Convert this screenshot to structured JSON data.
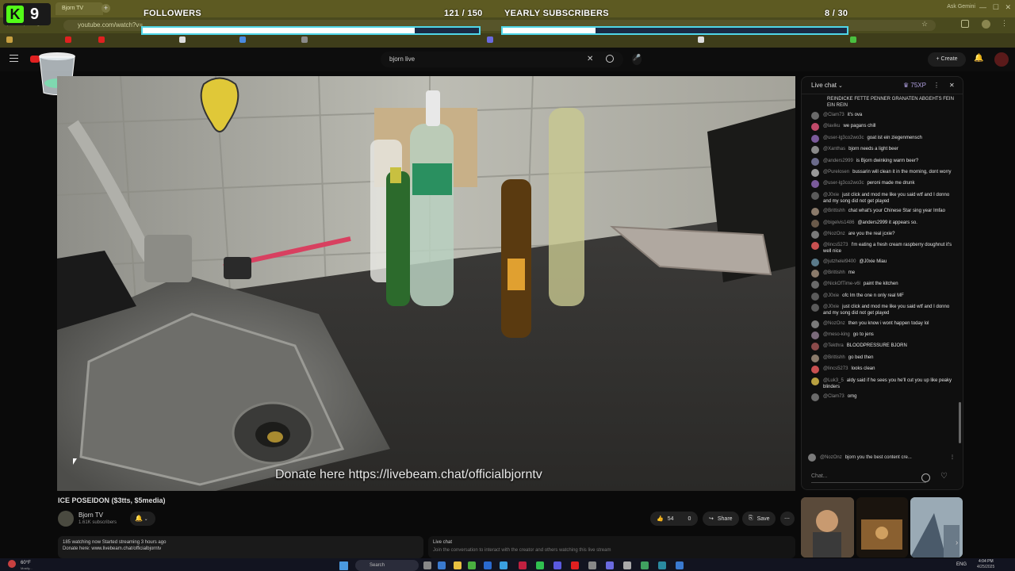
{
  "browser": {
    "tab_label": "Bjorn TV",
    "url": "youtube.com/watch?v=",
    "ask_gemini": "Ask Gemini"
  },
  "overlay": {
    "kick_level": "9",
    "followers_label": "FOLLOWERS",
    "followers_count": "121 / 150",
    "followers_progress": 0.81,
    "subs_label": "YEARLY SUBSCRIBERS",
    "subs_count": "8 / 30",
    "subs_progress": 0.27
  },
  "youtube": {
    "search_value": "bjorn live",
    "create_label": "Create",
    "video_caption": "Donate here https://livebeam.chat/officialbjorntv",
    "video_title": "ICE POSEIDON ($3tts, $5media)",
    "channel_name": "Bjorn TV",
    "subscribers": "1.61K subscribers",
    "likes": "54",
    "dislikes": "0",
    "share_label": "Share",
    "save_label": "Save",
    "description_line1": "185 watching now  Started streaming 3 hours ago",
    "description_line2": "Donate here:  www.livebeam.chat/officialbjorntv",
    "livechat_section": "Live chat",
    "livechat_note": "Join the conversation to interact with the creator and others watching this live stream"
  },
  "chat": {
    "title": "Live chat",
    "xp": "75XP",
    "input_placeholder": "Chat...",
    "pinned_top": "REINDICKE FETTE PENNER GRANATEN ABGEHTS FEIN EIN REIN",
    "messages": [
      {
        "author": "@Clam73",
        "text": "it's ova",
        "color": "#6a6a6a"
      },
      {
        "author": "@laviku",
        "text": "we pagans chill",
        "color": "#c04a6a"
      },
      {
        "author": "@user-lg3co2wo3c",
        "text": "goat ist ein ziegenmensch",
        "color": "#7a5a9a"
      },
      {
        "author": "@Xanthas",
        "text": "bjorn needs a light beer",
        "color": "#8a8a8a"
      },
      {
        "author": "@anders2999",
        "text": "is Bjorn dwinking warm beer?",
        "color": "#6a6a8a"
      },
      {
        "author": "@Purelosen",
        "text": "bussarin will clean it in the morning, dont worry",
        "color": "#9a9a9a"
      },
      {
        "author": "@user-lg3co2wo3c",
        "text": "peroni made me drunk",
        "color": "#7a5a9a"
      },
      {
        "author": "@J0xie",
        "text": "just click and mod me like you said wtf and I donno and my song did not get played",
        "color": "#5a5a5a"
      },
      {
        "author": "@Brittishh",
        "text": "chat what's your Chinese Star sing year Imfao",
        "color": "#8a7a6a"
      },
      {
        "author": "@bigelvis1486",
        "text": "@anders2999 it appears so.",
        "color": "#6a5a4a"
      },
      {
        "author": "@NozOnz",
        "text": "are you the real jcxie?",
        "color": "#7a7a7a"
      },
      {
        "author": "@lincs5273",
        "text": "I'm eating a fresh cream raspberry doughnut it's well nice",
        "color": "#c85050"
      },
      {
        "author": "@jutzhelel9400",
        "text": "@J0xie Miau",
        "color": "#5a7a8a"
      },
      {
        "author": "@Brittishh",
        "text": "me",
        "color": "#8a7a6a"
      },
      {
        "author": "@NickOfTime-v6l",
        "text": "paint the kitchen",
        "color": "#6a6a6a"
      },
      {
        "author": "@J0xie",
        "text": "ofc Im the one n only real MF",
        "color": "#5a5a5a"
      },
      {
        "author": "@J0xie",
        "text": "just click and mod me like you said wtf and I donno and my song did not get played",
        "color": "#5a5a5a"
      },
      {
        "author": "@NozOnz",
        "text": "then you know i wont happen today lol",
        "color": "#7a7a7a"
      },
      {
        "author": "@meso-king",
        "text": "go to jens",
        "color": "#7a6a7a"
      },
      {
        "author": "@Tekthra",
        "text": "BLOODPRESSURE BJORN",
        "color": "#8a4a4a"
      },
      {
        "author": "@Brittishh",
        "text": "go bed then",
        "color": "#8a7a6a"
      },
      {
        "author": "@lincs5273",
        "text": "looks clean",
        "color": "#c85050"
      },
      {
        "author": "@Luk3_5",
        "text": "aldy said if he sees you he'll cut you up like peaky blinders",
        "color": "#b8a040"
      },
      {
        "author": "@Clam73",
        "text": "omg",
        "color": "#6a6a6a"
      }
    ],
    "pinned_bottom_author": "@NozOnz",
    "pinned_bottom_text": "bjorn you the best content cre..."
  },
  "taskbar": {
    "weather": "60°F",
    "weather_sub": "Mostly...",
    "search_placeholder": "Search",
    "lang": "ENG",
    "time": "4:04 PM",
    "date": "4/25/2025"
  }
}
